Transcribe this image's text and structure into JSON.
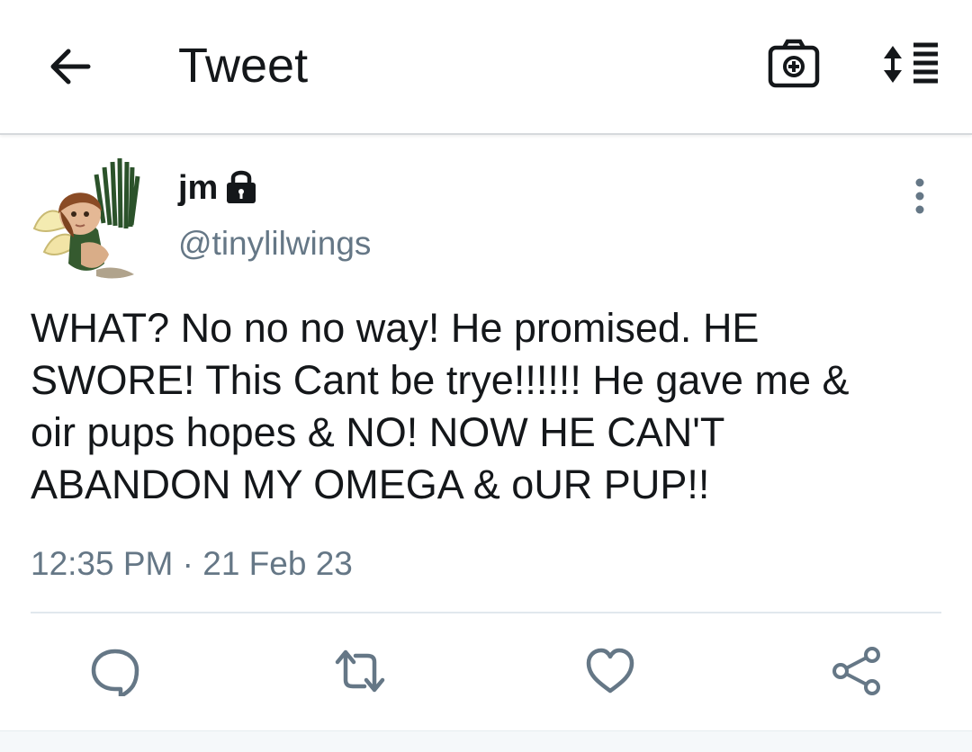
{
  "header": {
    "title": "Tweet"
  },
  "tweet": {
    "display_name": "jm",
    "handle": "@tinylilwings",
    "text": "WHAT? No no no way! He promised. HE SWORE! This Cant be trye!!!!!! He gave me &\noir pups hopes & NO! NOW HE CAN'T\nABANDON MY OMEGA & oUR PUP!!",
    "timestamp": "12:35 PM · 21 Feb 23",
    "protected": true
  },
  "icons": {
    "back": "arrow-left-icon",
    "camera": "camera-plus-icon",
    "sort": "sort-lines-icon",
    "lock": "lock-icon",
    "more": "more-vertical-icon",
    "reply": "reply-icon",
    "retweet": "retweet-icon",
    "like": "heart-icon",
    "share": "share-icon"
  },
  "colors": {
    "text": "#14171a",
    "secondary_text": "#657786",
    "icon": "#657786",
    "divider": "#e1e8ed"
  }
}
